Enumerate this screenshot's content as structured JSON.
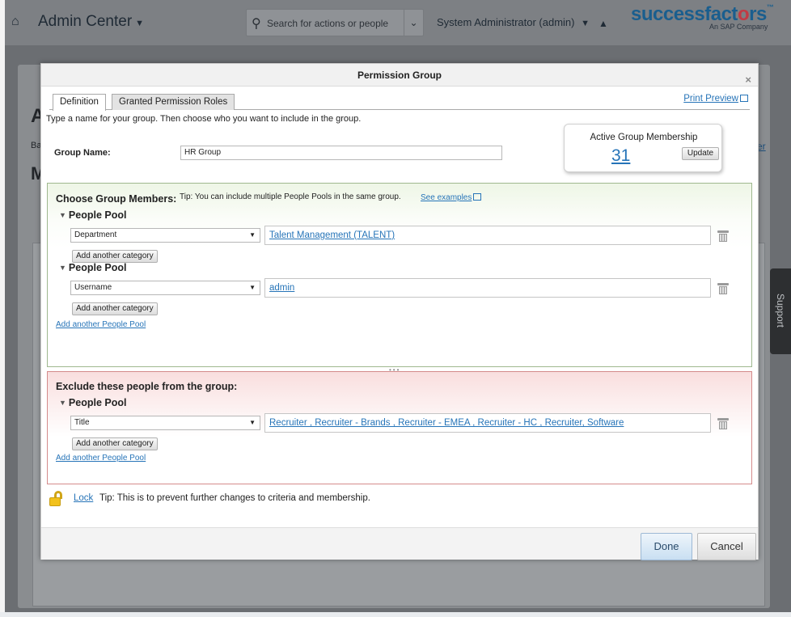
{
  "header": {
    "admin_center": "Admin Center",
    "search_placeholder": "Search for actions or people",
    "user": "System Administrator (admin)",
    "brand_main": "successfact",
    "brand_o": "o",
    "brand_end": "rs",
    "brand_tm": "™",
    "brand_sub": "An SAP Company"
  },
  "background": {
    "letter_a": "A",
    "letter_ba": "Ba",
    "letter_m": "M",
    "right_text": "er",
    "support": "Support"
  },
  "modal": {
    "title": "Permission Group",
    "close": "×",
    "tabs": [
      "Definition",
      "Granted Permission Roles"
    ],
    "print_preview": "Print Preview",
    "instructions": "Type a name for your group. Then choose who you want to include in the group.",
    "group_name_label": "Group Name:",
    "group_name_value": "HR Group",
    "active_membership": {
      "title": "Active Group Membership",
      "count": "31",
      "update": "Update"
    },
    "choose": {
      "title": "Choose Group Members:",
      "tip": "Tip: You can include multiple People Pools in the same group.",
      "see_examples": "See examples",
      "pools": [
        {
          "title": "People Pool",
          "category": "Department",
          "value": "Talent Management (TALENT)",
          "add_category": "Add another category"
        },
        {
          "title": "People Pool",
          "category": "Username",
          "value": "admin",
          "add_category": "Add another category"
        }
      ],
      "add_pool": "Add another People Pool"
    },
    "exclude": {
      "title": "Exclude these people from the group:",
      "pools": [
        {
          "title": "People Pool",
          "category": "Title",
          "value": "Recruiter , Recruiter - Brands , Recruiter - EMEA , Recruiter - HC , Recruiter, Software",
          "add_category": "Add another category"
        }
      ],
      "add_pool": "Add another People Pool"
    },
    "lock": {
      "link": "Lock",
      "tip": "Tip: This is to prevent further changes to criteria and membership."
    },
    "buttons": {
      "done": "Done",
      "cancel": "Cancel"
    }
  }
}
